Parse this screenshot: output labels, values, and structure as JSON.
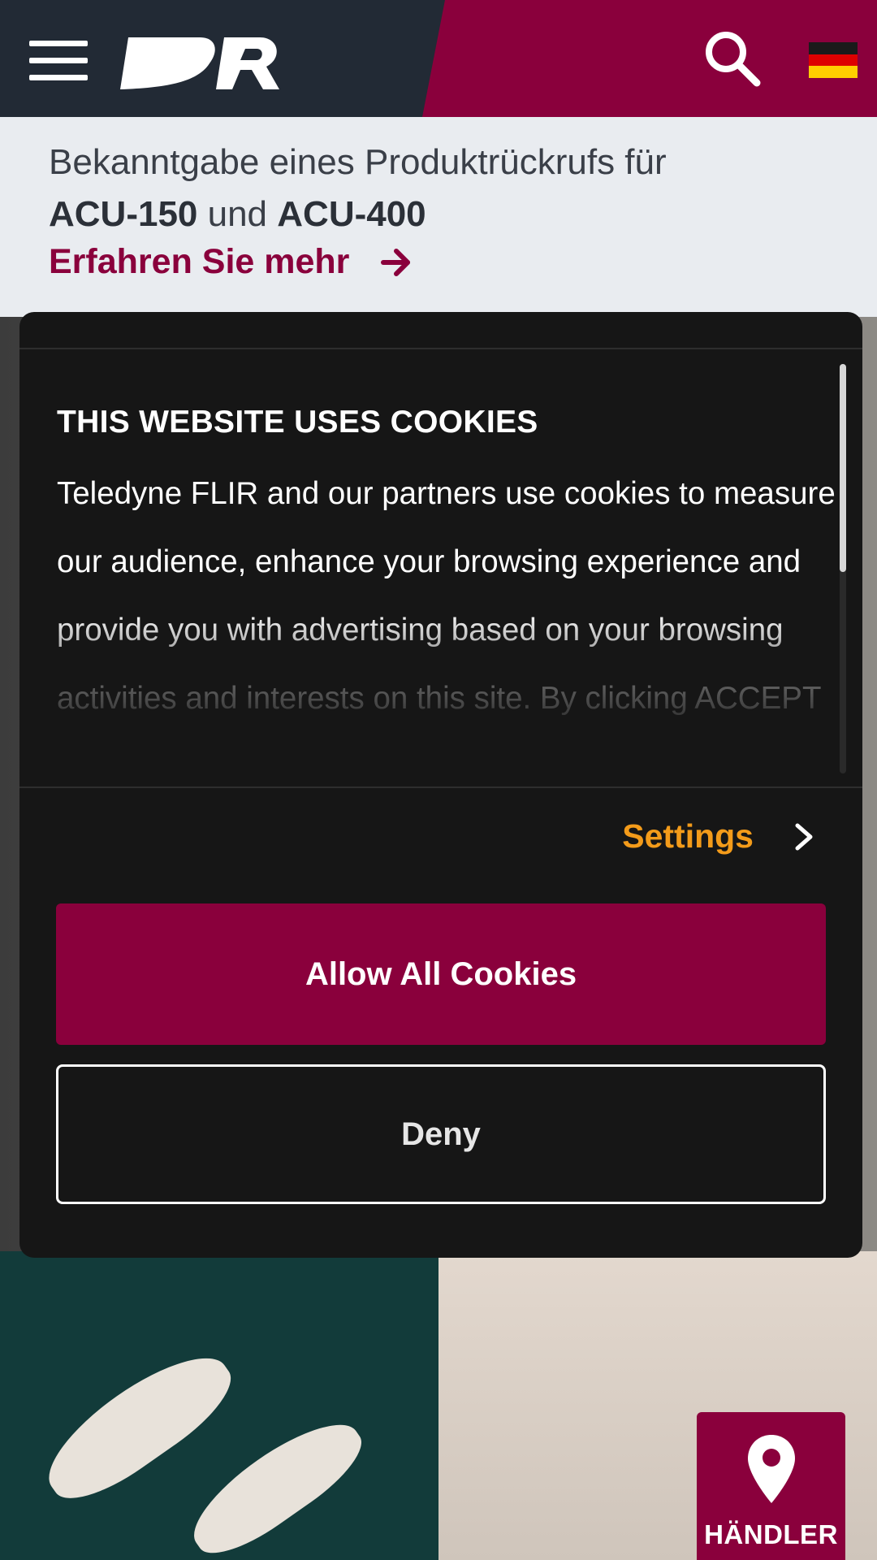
{
  "header": {
    "menu_icon": "hamburger-menu-icon",
    "logo_icon": "raymarine-logo-icon",
    "search_icon": "search-icon",
    "language_flag": "german-flag-icon",
    "accent_color": "#8a003c"
  },
  "announcement": {
    "line1": "Bekanntgabe eines Produktrückrufs für",
    "product1": "ACU-150",
    "connector": " und ",
    "product2": "ACU-400",
    "link_label": "Erfahren Sie mehr",
    "link_icon": "arrow-right-icon"
  },
  "cookie_banner": {
    "title": "THIS WEBSITE USES COOKIES",
    "body": "Teledyne FLIR and our partners use cookies to measure our audience, enhance your browsing experience and provide you with advertising based on your browsing activities and interests on this site. By clicking ACCEPT",
    "settings_label": "Settings",
    "settings_icon": "chevron-right-icon",
    "allow_label": "Allow All Cookies",
    "deny_label": "Deny",
    "settings_color": "#f39b1a"
  },
  "dealer_button": {
    "label": "HÄNDLER",
    "icon": "map-pin-icon"
  }
}
